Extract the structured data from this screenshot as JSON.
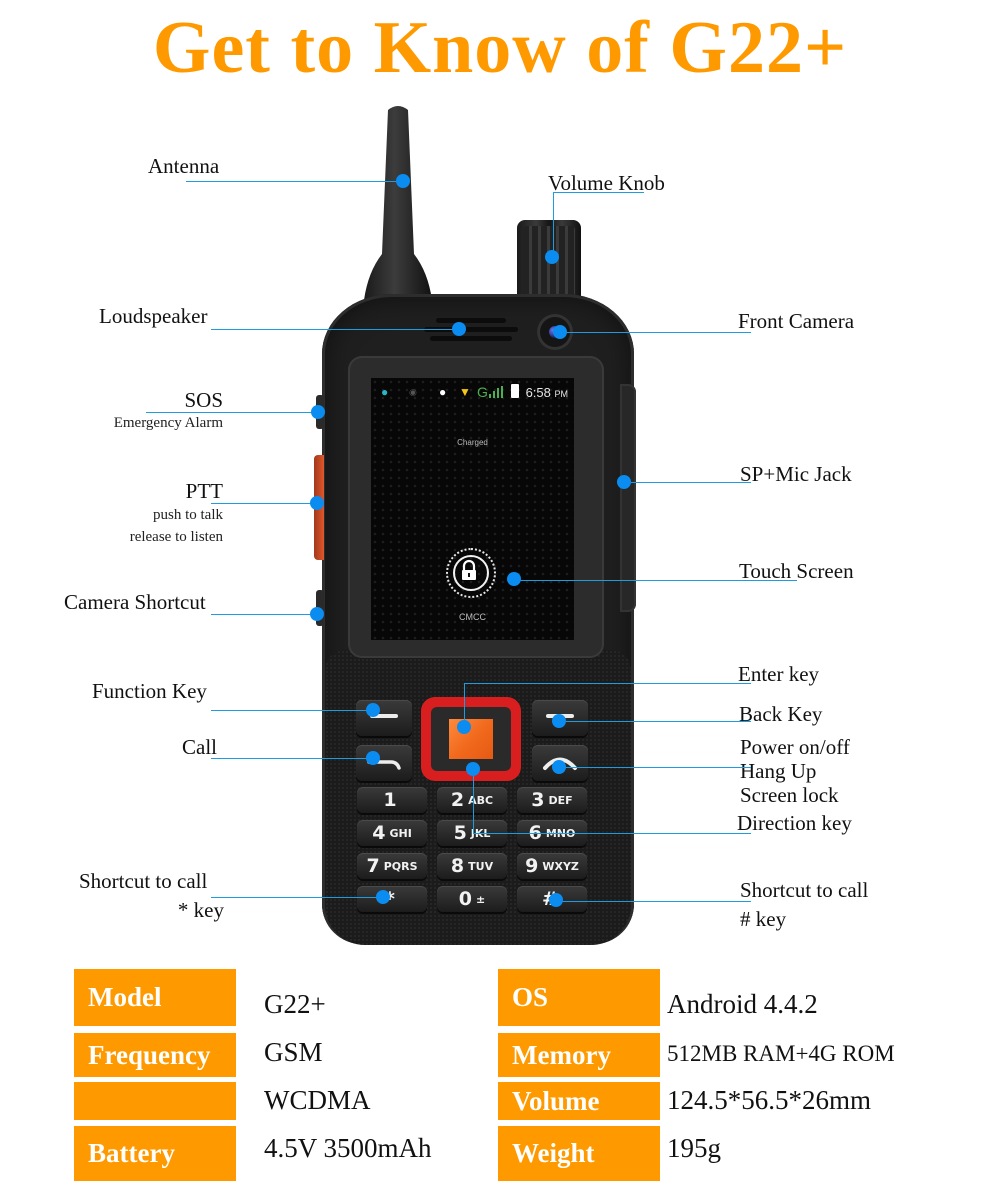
{
  "title": "Get to Know of G22+",
  "colors": {
    "accent_orange": "#ff9900",
    "callout_blue": "#1f9be0",
    "dpad_red": "#d81e1e",
    "enter_orange": "#f26a1e"
  },
  "screen": {
    "status_icons": [
      "chat-icon",
      "sync-icon",
      "location-pin-icon",
      "wifi-icon",
      "network-g-icon",
      "signal-bars-icon",
      "battery-icon"
    ],
    "network_type": "G",
    "time": "6:58",
    "time_suffix": "PM",
    "charged_text": "Charged",
    "carrier": "CMCC",
    "lock_icon": "padlock-icon"
  },
  "keypad": {
    "keys": [
      {
        "num": "1",
        "letters": ""
      },
      {
        "num": "2",
        "letters": "ABC"
      },
      {
        "num": "3",
        "letters": "DEF"
      },
      {
        "num": "4",
        "letters": "GHI"
      },
      {
        "num": "5",
        "letters": "JKL"
      },
      {
        "num": "6",
        "letters": "MNO"
      },
      {
        "num": "7",
        "letters": "PQRS"
      },
      {
        "num": "8",
        "letters": "TUV"
      },
      {
        "num": "9",
        "letters": "WXYZ"
      },
      {
        "num": "*",
        "letters": ""
      },
      {
        "num": "0",
        "letters": "±"
      },
      {
        "num": "#",
        "letters": ""
      }
    ]
  },
  "callouts": {
    "antenna": "Antenna",
    "volume_knob": "Volume Knob",
    "loudspeaker": "Loudspeaker",
    "front_camera": "Front Camera",
    "sos": "SOS",
    "sos_sub": "Emergency Alarm",
    "ptt": "PTT",
    "ptt_sub1": "push to talk",
    "ptt_sub2": "release to listen",
    "sp_mic_jack": "SP+Mic Jack",
    "touch_screen": "Touch Screen",
    "camera_shortcut": "Camera Shortcut",
    "function_key": "Function Key",
    "call": "Call",
    "enter_key": "Enter key",
    "back_key": "Back Key",
    "power_line1": "Power on/off",
    "power_line2": "Hang Up",
    "power_line3": "Screen lock",
    "direction_key": "Direction key",
    "shortcut_star_line1": "Shortcut to call",
    "shortcut_star_line2": "* key",
    "shortcut_hash_line1": "Shortcut to call",
    "shortcut_hash_line2": "# key"
  },
  "specs": {
    "left": [
      {
        "key": "Model",
        "value": "G22+"
      },
      {
        "key": "Frequency",
        "value": "GSM"
      },
      {
        "key": "",
        "value": "WCDMA"
      },
      {
        "key": "Battery",
        "value": "4.5V 3500mAh"
      }
    ],
    "right": [
      {
        "key": "OS",
        "value": "Android 4.4.2"
      },
      {
        "key": "Memory",
        "value": "512MB RAM+4G ROM"
      },
      {
        "key": "Volume",
        "value": "124.5*56.5*26mm"
      },
      {
        "key": "Weight",
        "value": "195g"
      }
    ]
  }
}
